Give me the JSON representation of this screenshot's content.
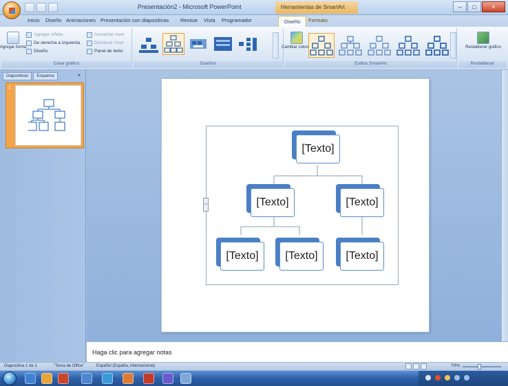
{
  "window": {
    "title": "Presentación2 - Microsoft PowerPoint",
    "contextual_title": "Herramientas de SmartArt"
  },
  "ribbon": {
    "tabs": [
      "Inicio",
      "Diseño",
      "Animaciones",
      "Presentación con diapositivas",
      "Revisar",
      "Vista",
      "Programador",
      "Diseño",
      "Formato"
    ],
    "active_tab": "Diseño",
    "groups": {
      "create_graphic": {
        "label": "Crear gráfico",
        "add_shape": "Agregar forma",
        "add_bullet": "Agregar viñeta",
        "right_to_left": "De derecha a izquierda",
        "layout": "Diseño",
        "promote": "Aumentar nivel",
        "demote": "Disminuir nivel",
        "text_pane": "Panel de texto"
      },
      "layouts": {
        "label": "Diseños"
      },
      "smartart_styles": {
        "label": "Estilos SmartArt",
        "change_colors": "Cambiar colores"
      },
      "reset": {
        "label": "Restablecer",
        "reset_graphic": "Restablecer gráfico"
      }
    }
  },
  "left_pane": {
    "tabs": [
      "Diapositivas",
      "Esquema"
    ],
    "slide_number": "1"
  },
  "smartart": {
    "nodes": [
      "[Texto]",
      "[Texto]",
      "[Texto]",
      "[Texto]",
      "[Texto]",
      "[Texto]"
    ]
  },
  "notes": {
    "placeholder": "Haga clic para agregar notas"
  },
  "status": {
    "slide": "Diapositiva 1 de 1",
    "theme": "\"Tema de Office\"",
    "language": "Español (España, internacional)",
    "zoom": "70%"
  },
  "colors": {
    "node_back": "#4a7fc5",
    "selected_thumb": "#f3a54a",
    "ribbon_highlight": "#e0a43c"
  }
}
